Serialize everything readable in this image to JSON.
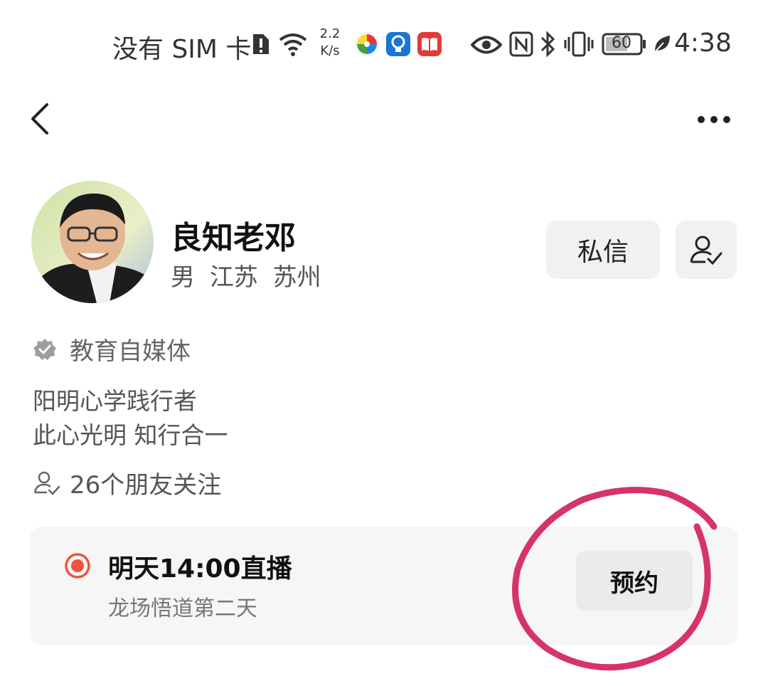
{
  "status_bar": {
    "carrier": "没有 SIM 卡",
    "speed_value": "2.2",
    "speed_unit": "K/s",
    "battery": "60",
    "time": "4:38"
  },
  "header": {
    "back_icon": "chevron-left-icon",
    "more_icon": "more-horizontal-icon"
  },
  "profile": {
    "name": "良知老邓",
    "gender": "男",
    "province": "江苏",
    "city": "苏州",
    "message_label": "私信",
    "follow_icon": "user-check-icon",
    "verification": "教育自媒体",
    "bio_line1": "阳明心学践行者",
    "bio_line2": "此心光明  知行合一",
    "friends_following": "26个朋友关注"
  },
  "live": {
    "title": "明天14:00直播",
    "subtitle": "龙场悟道第二天",
    "reserve_label": "预约",
    "accent_color": "#f0533e"
  },
  "annotation": {
    "stroke_color": "#d6336c"
  }
}
